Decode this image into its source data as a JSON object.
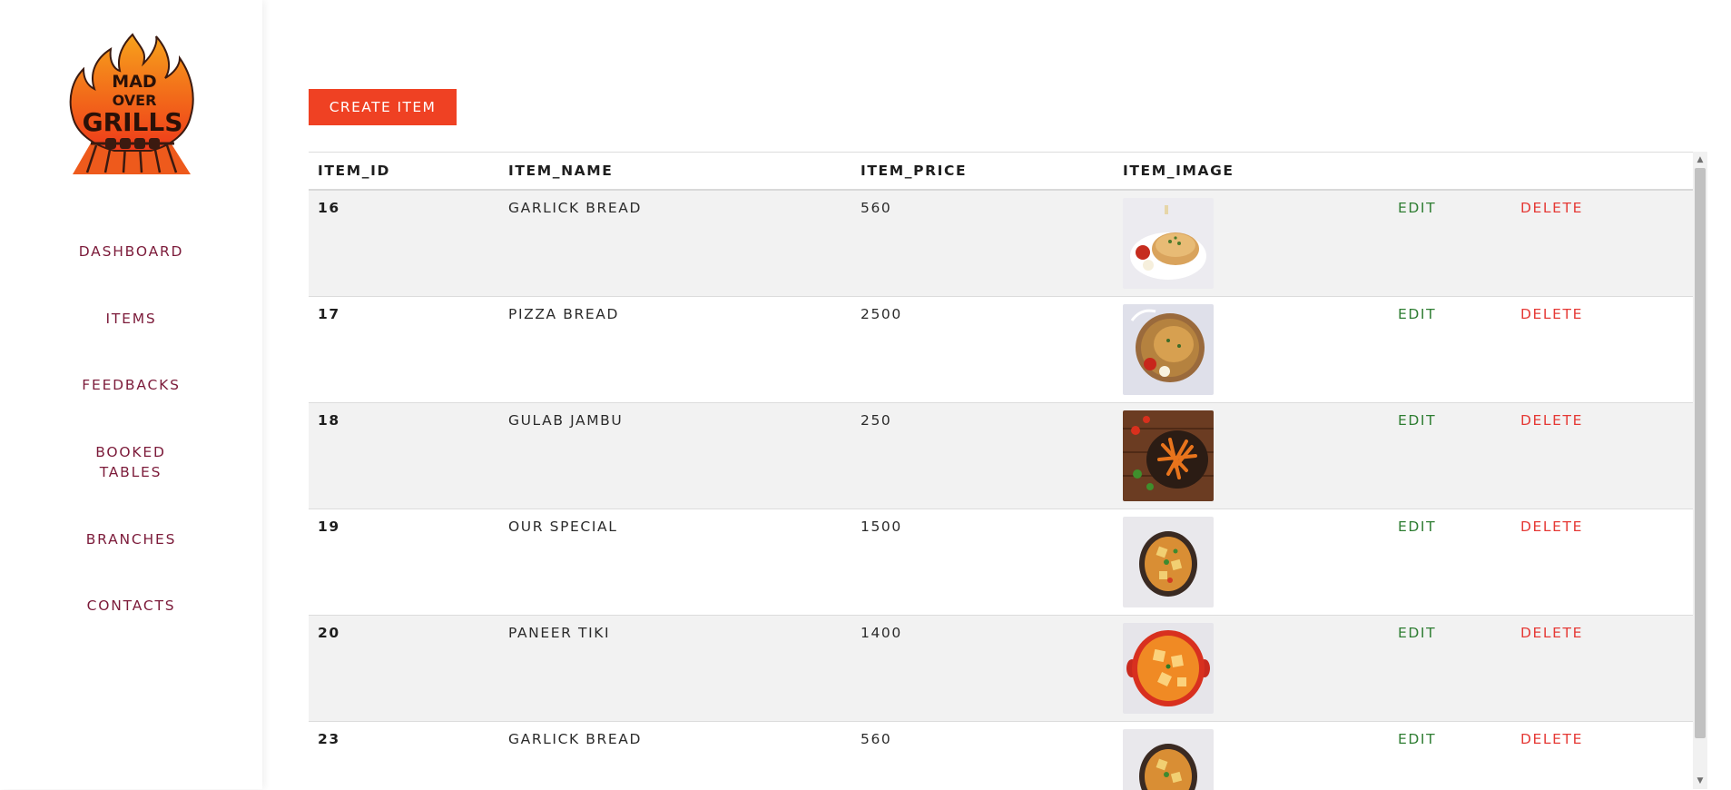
{
  "brand": {
    "logo_text_1": "MAD",
    "logo_text_2": "OVER",
    "logo_text_3": "GRILLS"
  },
  "sidebar": {
    "items": [
      {
        "label": "DASHBOARD"
      },
      {
        "label": "ITEMS"
      },
      {
        "label": "FEEDBACKS"
      },
      {
        "label": "BOOKED TABLES"
      },
      {
        "label": "BRANCHES"
      },
      {
        "label": "CONTACTS"
      }
    ]
  },
  "toolbar": {
    "create_label": "CREATE ITEM"
  },
  "table": {
    "headers": [
      "ITEM_ID",
      "ITEM_NAME",
      "ITEM_PRICE",
      "ITEM_IMAGE"
    ],
    "edit_label": "EDIT",
    "delete_label": "DELETE",
    "rows": [
      {
        "id": "16",
        "name": "GARLICK BREAD",
        "price": "560",
        "image": "garlic-bread-plate"
      },
      {
        "id": "17",
        "name": "PIZZA BREAD",
        "price": "2500",
        "image": "pizza-bread-pan"
      },
      {
        "id": "18",
        "name": "GULAB JAMBU",
        "price": "250",
        "image": "pasta-bowl"
      },
      {
        "id": "19",
        "name": "OUR SPECIAL",
        "price": "1500",
        "image": "curry-bowl"
      },
      {
        "id": "20",
        "name": "PANEER TIKI",
        "price": "1400",
        "image": "paneer-curry-pot"
      },
      {
        "id": "23",
        "name": "GARLICK BREAD",
        "price": "560",
        "image": "curry-bowl"
      }
    ]
  },
  "colors": {
    "accent": "#ef4123",
    "nav_text": "#7c1b3a",
    "edit": "#2e7d32",
    "delete": "#e53935"
  }
}
